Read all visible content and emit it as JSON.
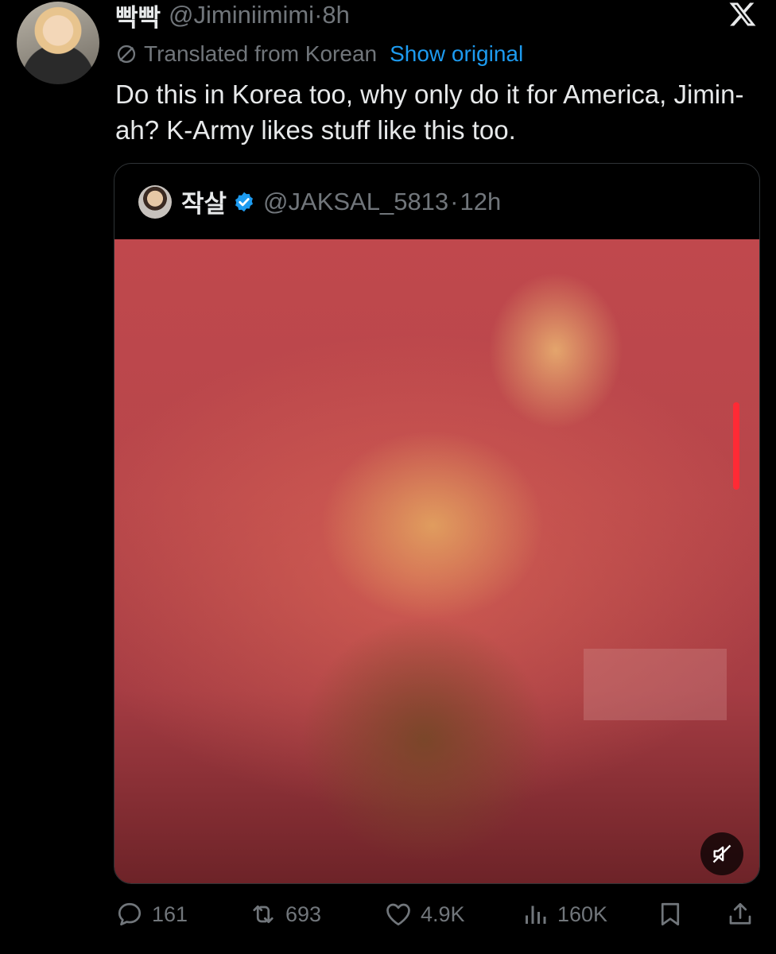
{
  "post": {
    "author_name": "빡빡",
    "author_handle": "@Jiminiimimi",
    "separator": "·",
    "time": "8h",
    "translated_label": "Translated from Korean",
    "show_original": "Show original",
    "body": "Do this in Korea too, why only do it for America, Jimin-ah? K-Army likes stuff like this too."
  },
  "quote": {
    "author_name": "작살",
    "author_handle": "@JAKSAL_5813",
    "separator": "·",
    "time": "12h"
  },
  "actions": {
    "replies": "161",
    "reposts": "693",
    "likes": "4.9K",
    "views": "160K"
  },
  "icons": {
    "platform": "x-logo-icon",
    "translate": "translate-icon",
    "verified": "verified-badge-icon",
    "mute": "volume-muted-icon",
    "reply": "reply-icon",
    "repost": "repost-icon",
    "like": "heart-icon",
    "views": "views-icon",
    "bookmark": "bookmark-icon",
    "share": "share-icon"
  },
  "colors": {
    "accent": "#1d9bf0",
    "text": "#e7e9ea",
    "muted": "#71767b",
    "background": "#000000"
  }
}
